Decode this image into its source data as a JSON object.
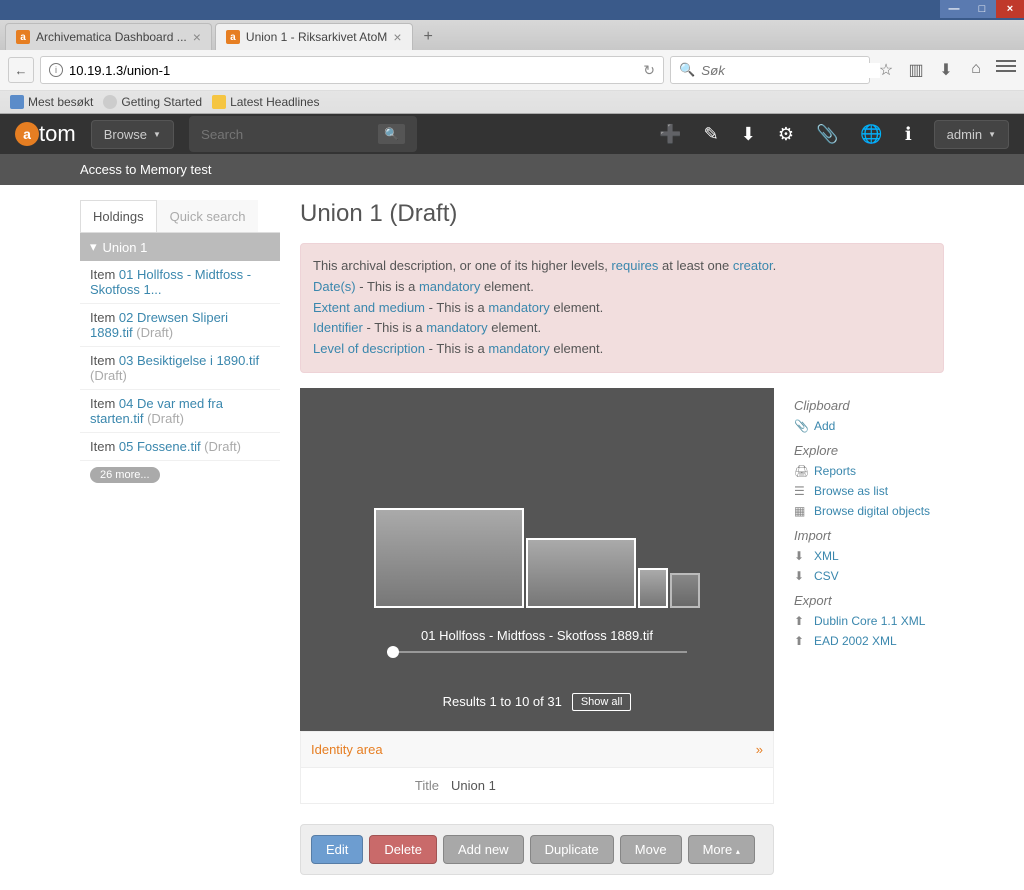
{
  "browser": {
    "tabs": [
      {
        "title": "Archivematica Dashboard ...",
        "active": false
      },
      {
        "title": "Union 1 - Riksarkivet AtoM",
        "active": true
      }
    ],
    "url": "10.19.1.3/union-1",
    "search_placeholder": "Søk",
    "bookmarks": [
      "Mest besøkt",
      "Getting Started",
      "Latest Headlines"
    ]
  },
  "app_header": {
    "logo_text": "tom",
    "browse": "Browse",
    "search_placeholder": "Search",
    "admin": "admin"
  },
  "subheader": "Access to Memory test",
  "sidebar": {
    "tabs": {
      "holdings": "Holdings",
      "quick": "Quick search"
    },
    "root": "Union 1",
    "prefix": "Item",
    "draft": "(Draft)",
    "items": [
      {
        "link": "01 Hollfoss - Midtfoss - Skotfoss 1..."
      },
      {
        "link": "02 Drewsen Sliperi 1889.tif",
        "draft": true
      },
      {
        "link": "03 Besiktigelse i 1890.tif",
        "draft": true
      },
      {
        "link": "04 De var med fra starten.tif",
        "draft": true
      },
      {
        "link": "05 Fossene.tif",
        "draft": true
      }
    ],
    "more": "26 more..."
  },
  "page_title": "Union 1 (Draft)",
  "alert": {
    "line1a": "This archival description, or one of its higher levels, ",
    "line1_req": "requires",
    "line1b": " at least one ",
    "line1_cre": "creator",
    "link_dates": "Date(s)",
    "link_extent": "Extent and medium",
    "link_ident": "Identifier",
    "link_level": "Level of description",
    "thisisa": " - This is a ",
    "mandatory": "mandatory",
    "element": " element."
  },
  "viewer": {
    "caption": "01 Hollfoss - Midtfoss - Skotfoss 1889.tif",
    "results": "Results 1 to 10 of 31",
    "showall": "Show all"
  },
  "identity": {
    "header": "Identity area",
    "title_label": "Title",
    "title_value": "Union 1"
  },
  "actions": {
    "edit": "Edit",
    "delete": "Delete",
    "add": "Add new",
    "dup": "Duplicate",
    "move": "Move",
    "more": "More"
  },
  "rightcol": {
    "clipboard": "Clipboard",
    "add": "Add",
    "explore": "Explore",
    "reports": "Reports",
    "browse_list": "Browse as list",
    "browse_digital": "Browse digital objects",
    "import": "Import",
    "xml": "XML",
    "csv": "CSV",
    "export": "Export",
    "dc": "Dublin Core 1.1 XML",
    "ead": "EAD 2002 XML"
  }
}
